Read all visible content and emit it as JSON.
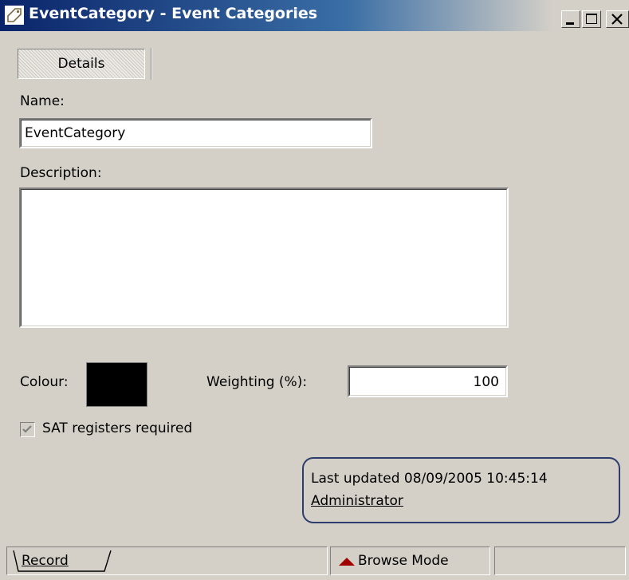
{
  "window": {
    "title": "EventCategory - Event Categories",
    "buttons": {
      "minimize": "minimize",
      "maximize": "maximize",
      "close": "close"
    }
  },
  "tabs": [
    {
      "label": "Details"
    }
  ],
  "form": {
    "name_label": "Name:",
    "name_value": "EventCategory",
    "description_label": "Description:",
    "description_value": "",
    "colour_label": "Colour:",
    "colour_value": "#000000",
    "weighting_label": "Weighting (%):",
    "weighting_value": "100",
    "sat_checkbox_label": "SAT registers required",
    "sat_checked": true
  },
  "audit": {
    "last_updated": "Last updated 08/09/2005 10:45:14",
    "user": "Administrator"
  },
  "statusbar": {
    "record_tab": "Record",
    "mode": "Browse Mode",
    "mode_icon": "triangle-up-icon",
    "mode_icon_color": "#a00000"
  },
  "colors": {
    "window_bg": "#d4d0c8",
    "titlebar_start": "#0a246a",
    "titlebar_end": "#3a6ea5"
  }
}
